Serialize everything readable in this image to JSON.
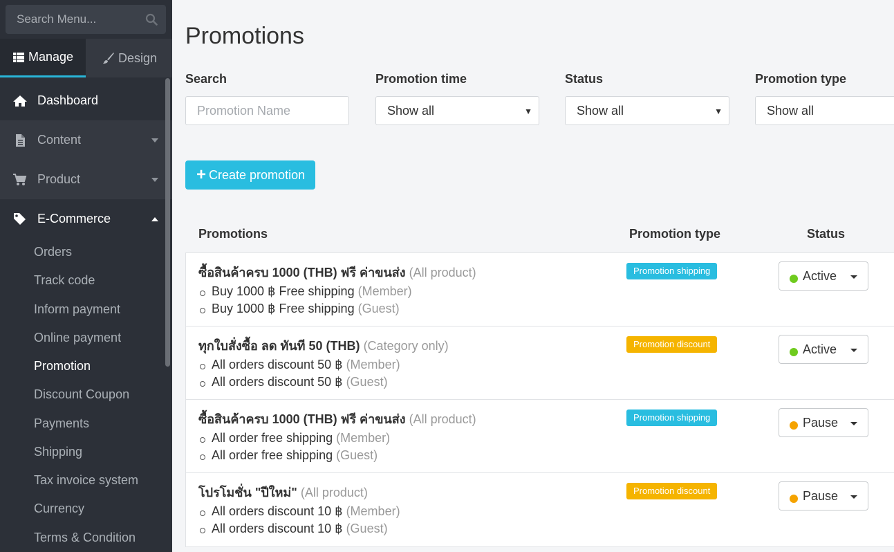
{
  "sidebar": {
    "search_placeholder": "Search Menu...",
    "tabs": [
      {
        "label": "Manage",
        "active": true
      },
      {
        "label": "Design",
        "active": false
      }
    ],
    "nav": [
      {
        "label": "Dashboard",
        "icon": "home-icon"
      },
      {
        "label": "Content",
        "icon": "document-icon"
      },
      {
        "label": "Product",
        "icon": "cart-icon"
      },
      {
        "label": "E-Commerce",
        "icon": "tag-icon"
      }
    ],
    "ecommerce_items": [
      "Orders",
      "Track code",
      "Inform payment",
      "Online payment",
      "Promotion",
      "Discount Coupon",
      "Payments",
      "Shipping",
      "Tax invoice system",
      "Currency",
      "Terms & Condition"
    ],
    "active_item": "Promotion"
  },
  "main": {
    "title": "Promotions",
    "filters": {
      "search_label": "Search",
      "search_placeholder": "Promotion Name",
      "time_label": "Promotion time",
      "time_value": "Show all",
      "status_label": "Status",
      "status_value": "Show all",
      "type_label": "Promotion type",
      "type_value": "Show all"
    },
    "create_button": "Create promotion",
    "table": {
      "headers": [
        "Promotions",
        "Promotion type",
        "Status"
      ],
      "rows": [
        {
          "name": "ซื้อสินค้าครบ 1000 (THB) ฟรี ค่าขนส่ง",
          "scope": "(All product)",
          "rules": [
            {
              "text": "Buy 1000 ฿ Free shipping",
              "audience": "(Member)"
            },
            {
              "text": "Buy 1000 ฿ Free shipping",
              "audience": "(Guest)"
            }
          ],
          "type": "Promotion shipping",
          "status": "Active"
        },
        {
          "name": "ทุกใบสั่งซื้อ ลด ทันที 50 (THB)",
          "scope": "(Category only)",
          "rules": [
            {
              "text": "All orders discount 50 ฿",
              "audience": "(Member)"
            },
            {
              "text": "All orders discount 50 ฿",
              "audience": "(Guest)"
            }
          ],
          "type": "Promotion discount",
          "status": "Active"
        },
        {
          "name": "ซื้อสินค้าครบ 1000 (THB) ฟรี ค่าขนส่ง",
          "scope": "(All product)",
          "rules": [
            {
              "text": "All order free shipping",
              "audience": "(Member)"
            },
            {
              "text": "All order free shipping",
              "audience": "(Guest)"
            }
          ],
          "type": "Promotion shipping",
          "status": "Pause"
        },
        {
          "name": "โปรโมชั่น \"ปีใหม่\"",
          "scope": "(All product)",
          "rules": [
            {
              "text": "All orders discount 10 ฿",
              "audience": "(Member)"
            },
            {
              "text": "All orders discount 10 ฿",
              "audience": "(Guest)"
            }
          ],
          "type": "Promotion discount",
          "status": "Pause"
        }
      ]
    }
  },
  "colors": {
    "sidebar_bg": "#2c3038",
    "accent": "#29bde0",
    "badge_shipping": "#29bde0",
    "badge_discount": "#f5b400",
    "status_active": "#6fcb1e",
    "status_pause": "#f5a300"
  }
}
